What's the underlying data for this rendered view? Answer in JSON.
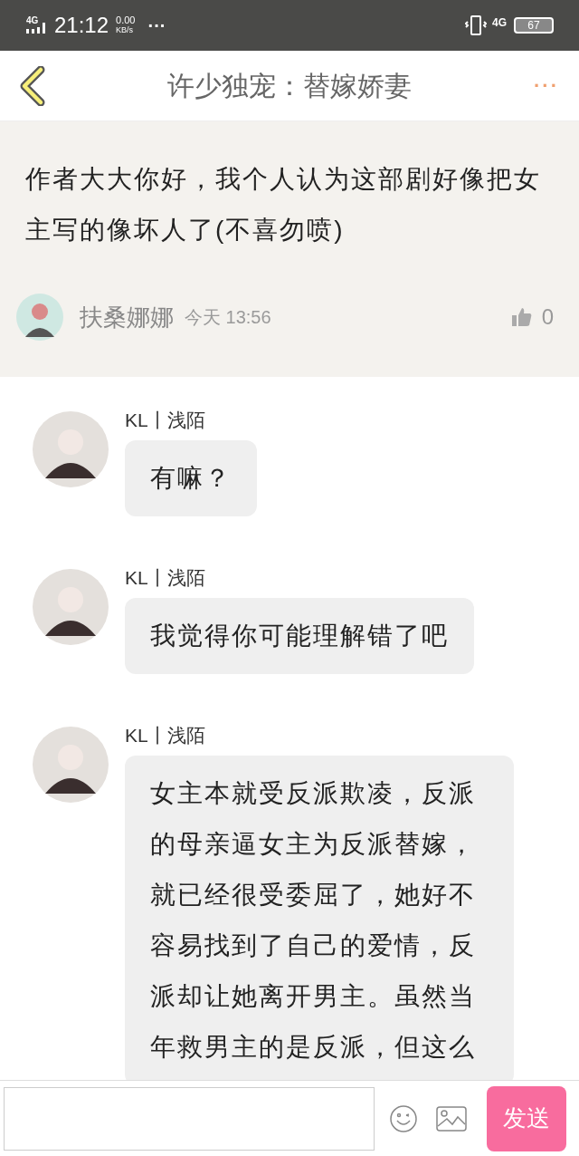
{
  "status_bar": {
    "network": "4G",
    "time": "21:12",
    "speed": "0.00",
    "speed_unit": "KB/s",
    "more": "···",
    "data_network": "4G",
    "battery": "67"
  },
  "header": {
    "title": "许少独宠：替嫁娇妻",
    "more": "···"
  },
  "comment": {
    "text": "作者大大你好，我个人认为这部剧好像把女主写的像坏人了(不喜勿喷)",
    "author": "扶桑娜娜",
    "time": "今天 13:56",
    "likes": "0"
  },
  "replies": [
    {
      "author": "KL丨浅陌",
      "text": "有嘛？"
    },
    {
      "author": "KL丨浅陌",
      "text": "我觉得你可能理解错了吧"
    },
    {
      "author": "KL丨浅陌",
      "text": "女主本就受反派欺凌，反派的母亲逼女主为反派替嫁，就已经很受委屈了，她好不容易找到了自己的爱情，反派却让她离开男主。虽然当年救男主的是反派，但这么"
    }
  ],
  "composer": {
    "send": "发送"
  }
}
